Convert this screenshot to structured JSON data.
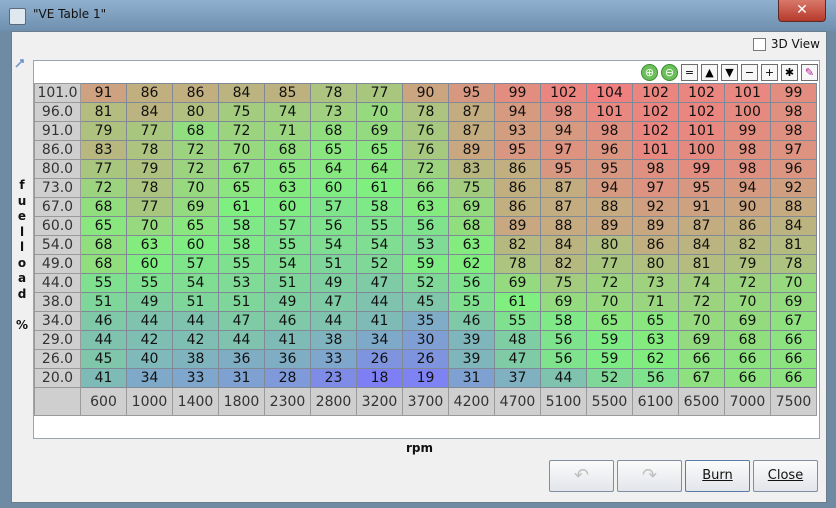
{
  "window": {
    "title": "\"VE Table 1\"",
    "close_glyph": "✕"
  },
  "options": {
    "view3d_label": "3D View"
  },
  "table": {
    "y_axis_label": "fuelload %",
    "x_axis_label": "rpm",
    "row_labels": [
      "101.0",
      "96.0",
      "91.0",
      "86.0",
      "80.0",
      "73.0",
      "67.0",
      "60.0",
      "54.0",
      "49.0",
      "44.0",
      "38.0",
      "34.0",
      "29.0",
      "26.0",
      "20.0"
    ],
    "col_labels": [
      "600",
      "1000",
      "1400",
      "1800",
      "2300",
      "2800",
      "3200",
      "3700",
      "4200",
      "4700",
      "5100",
      "5500",
      "6100",
      "6500",
      "7000",
      "7500"
    ],
    "values": [
      [
        91,
        86,
        86,
        84,
        85,
        78,
        77,
        90,
        95,
        99,
        102,
        104,
        102,
        102,
        101,
        99
      ],
      [
        81,
        84,
        80,
        75,
        74,
        73,
        70,
        78,
        87,
        94,
        98,
        101,
        102,
        102,
        100,
        98
      ],
      [
        79,
        77,
        68,
        72,
        71,
        68,
        69,
        76,
        87,
        93,
        94,
        98,
        102,
        101,
        99,
        98
      ],
      [
        83,
        78,
        72,
        70,
        68,
        65,
        65,
        76,
        89,
        95,
        97,
        96,
        101,
        100,
        98,
        97
      ],
      [
        77,
        79,
        72,
        67,
        65,
        64,
        64,
        72,
        83,
        86,
        95,
        95,
        98,
        99,
        98,
        96
      ],
      [
        72,
        78,
        70,
        65,
        63,
        60,
        61,
        66,
        75,
        86,
        87,
        94,
        97,
        95,
        94,
        92
      ],
      [
        68,
        77,
        69,
        61,
        60,
        57,
        58,
        63,
        69,
        86,
        87,
        88,
        92,
        91,
        90,
        88
      ],
      [
        65,
        70,
        65,
        58,
        57,
        56,
        55,
        56,
        68,
        89,
        88,
        89,
        89,
        87,
        86,
        84
      ],
      [
        68,
        63,
        60,
        58,
        55,
        54,
        54,
        53,
        63,
        82,
        84,
        80,
        86,
        84,
        82,
        81
      ],
      [
        68,
        60,
        57,
        55,
        54,
        51,
        52,
        59,
        62,
        78,
        82,
        77,
        80,
        81,
        79,
        78
      ],
      [
        55,
        55,
        54,
        53,
        51,
        49,
        47,
        52,
        56,
        69,
        75,
        72,
        73,
        74,
        72,
        70
      ],
      [
        51,
        49,
        51,
        51,
        49,
        47,
        44,
        45,
        55,
        61,
        69,
        70,
        71,
        72,
        70,
        69
      ],
      [
        46,
        44,
        44,
        47,
        46,
        44,
        41,
        35,
        46,
        55,
        58,
        65,
        65,
        70,
        69,
        67
      ],
      [
        44,
        42,
        42,
        44,
        41,
        38,
        34,
        30,
        39,
        48,
        56,
        59,
        63,
        69,
        68,
        66
      ],
      [
        45,
        40,
        38,
        36,
        36,
        33,
        26,
        26,
        39,
        47,
        56,
        59,
        62,
        66,
        66,
        66
      ],
      [
        41,
        34,
        33,
        31,
        28,
        23,
        18,
        19,
        31,
        37,
        44,
        52,
        56,
        67,
        66,
        66
      ]
    ],
    "color_scale": {
      "min": 18,
      "max": 104,
      "low_color": "#7f7ff5",
      "mid_color": "#7ff07f",
      "high_color": "#f08080"
    }
  },
  "toolbar": {
    "buttons": [
      {
        "name": "zoom-in-icon",
        "glyph": "⊕"
      },
      {
        "name": "zoom-out-icon",
        "glyph": "⊖"
      },
      {
        "name": "set-equal-icon",
        "glyph": "="
      },
      {
        "name": "increase-icon",
        "glyph": "▲"
      },
      {
        "name": "decrease-icon",
        "glyph": "▼"
      },
      {
        "name": "subtract-icon",
        "glyph": "−"
      },
      {
        "name": "add-icon",
        "glyph": "+"
      },
      {
        "name": "multiply-icon",
        "glyph": "✱"
      },
      {
        "name": "pen-icon",
        "glyph": "✎"
      }
    ]
  },
  "buttons": {
    "undo_glyph": "↶",
    "redo_glyph": "↷",
    "burn_label": "Burn",
    "close_label": "Close"
  }
}
